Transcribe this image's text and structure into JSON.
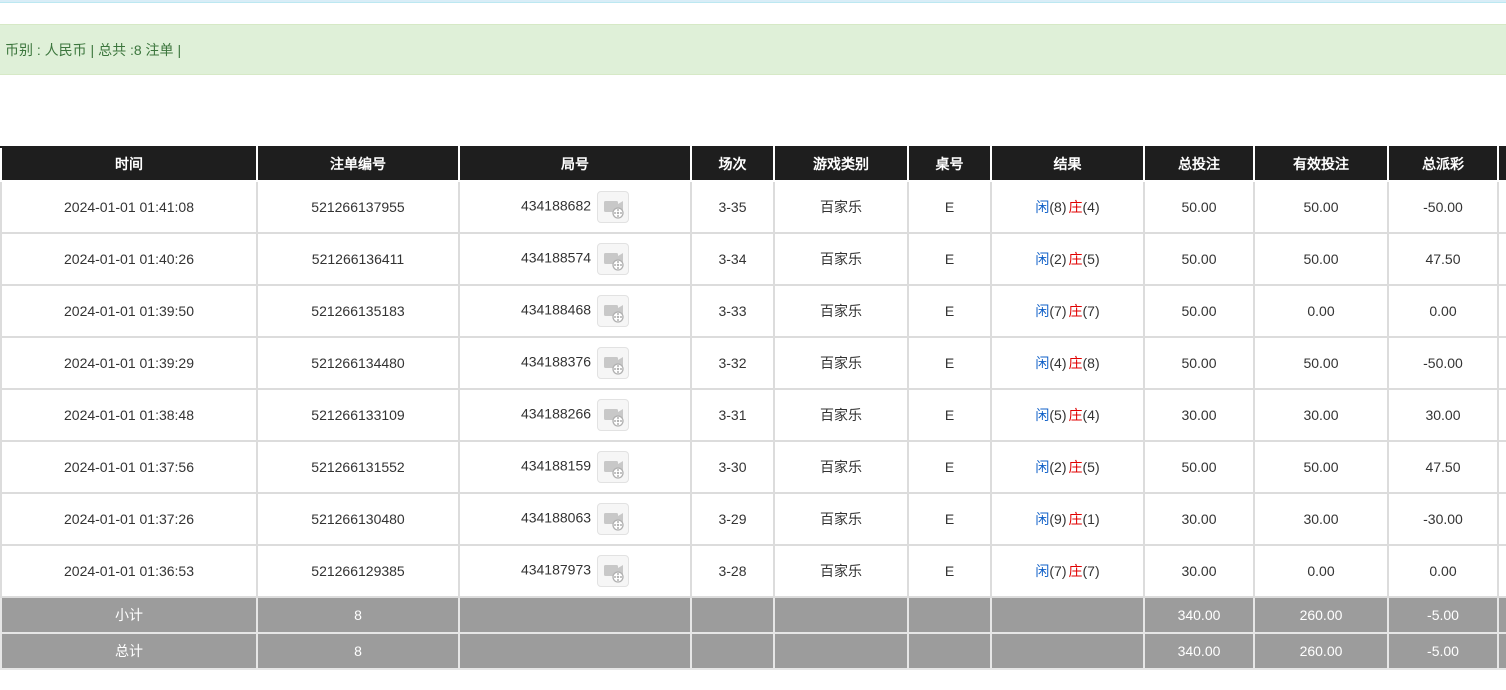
{
  "summary": {
    "currency_label": "币别 : ",
    "currency": "人民币",
    "sep1": " | ",
    "total_label": "总共 :",
    "total_count": "8",
    "total_unit": " 注单",
    "sep2": " |"
  },
  "columns": [
    "时间",
    "注单编号",
    "局号",
    "场次",
    "游戏类别",
    "桌号",
    "结果",
    "总投注",
    "有效投注",
    "总派彩"
  ],
  "rows": [
    {
      "time": "2024-01-01 01:41:08",
      "bet_no": "521266137955",
      "round_no": "434188682",
      "session": "3-35",
      "game": "百家乐",
      "table": "E",
      "player_label": "闲",
      "player_val": "(8)",
      "banker_label": "庄",
      "banker_val": "(4)",
      "total_bet": "50.00",
      "valid_bet": "50.00",
      "payout": "-50.00"
    },
    {
      "time": "2024-01-01 01:40:26",
      "bet_no": "521266136411",
      "round_no": "434188574",
      "session": "3-34",
      "game": "百家乐",
      "table": "E",
      "player_label": "闲",
      "player_val": "(2)",
      "banker_label": "庄",
      "banker_val": "(5)",
      "total_bet": "50.00",
      "valid_bet": "50.00",
      "payout": "47.50"
    },
    {
      "time": "2024-01-01 01:39:50",
      "bet_no": "521266135183",
      "round_no": "434188468",
      "session": "3-33",
      "game": "百家乐",
      "table": "E",
      "player_label": "闲",
      "player_val": "(7)",
      "banker_label": "庄",
      "banker_val": "(7)",
      "total_bet": "50.00",
      "valid_bet": "0.00",
      "payout": "0.00"
    },
    {
      "time": "2024-01-01 01:39:29",
      "bet_no": "521266134480",
      "round_no": "434188376",
      "session": "3-32",
      "game": "百家乐",
      "table": "E",
      "player_label": "闲",
      "player_val": "(4)",
      "banker_label": "庄",
      "banker_val": "(8)",
      "total_bet": "50.00",
      "valid_bet": "50.00",
      "payout": "-50.00"
    },
    {
      "time": "2024-01-01 01:38:48",
      "bet_no": "521266133109",
      "round_no": "434188266",
      "session": "3-31",
      "game": "百家乐",
      "table": "E",
      "player_label": "闲",
      "player_val": "(5)",
      "banker_label": "庄",
      "banker_val": "(4)",
      "total_bet": "30.00",
      "valid_bet": "30.00",
      "payout": "30.00"
    },
    {
      "time": "2024-01-01 01:37:56",
      "bet_no": "521266131552",
      "round_no": "434188159",
      "session": "3-30",
      "game": "百家乐",
      "table": "E",
      "player_label": "闲",
      "player_val": "(2)",
      "banker_label": "庄",
      "banker_val": "(5)",
      "total_bet": "50.00",
      "valid_bet": "50.00",
      "payout": "47.50"
    },
    {
      "time": "2024-01-01 01:37:26",
      "bet_no": "521266130480",
      "round_no": "434188063",
      "session": "3-29",
      "game": "百家乐",
      "table": "E",
      "player_label": "闲",
      "player_val": "(9)",
      "banker_label": "庄",
      "banker_val": "(1)",
      "total_bet": "30.00",
      "valid_bet": "30.00",
      "payout": "-30.00"
    },
    {
      "time": "2024-01-01 01:36:53",
      "bet_no": "521266129385",
      "round_no": "434187973",
      "session": "3-28",
      "game": "百家乐",
      "table": "E",
      "player_label": "闲",
      "player_val": "(7)",
      "banker_label": "庄",
      "banker_val": "(7)",
      "total_bet": "30.00",
      "valid_bet": "0.00",
      "payout": "0.00"
    }
  ],
  "subtotal": {
    "label": "小计",
    "count": "8",
    "total_bet": "340.00",
    "valid_bet": "260.00",
    "payout": "-5.00"
  },
  "grandtotal": {
    "label": "总计",
    "count": "8",
    "total_bet": "340.00",
    "valid_bet": "260.00",
    "payout": "-5.00"
  },
  "colors": {
    "player": "#1060c8",
    "banker": "#e00000",
    "header_bg": "#1e1e1e",
    "footer_bg": "#9c9c9c",
    "info_bg": "#dff0d8"
  },
  "icons": {
    "replay": "video-replay-icon"
  }
}
